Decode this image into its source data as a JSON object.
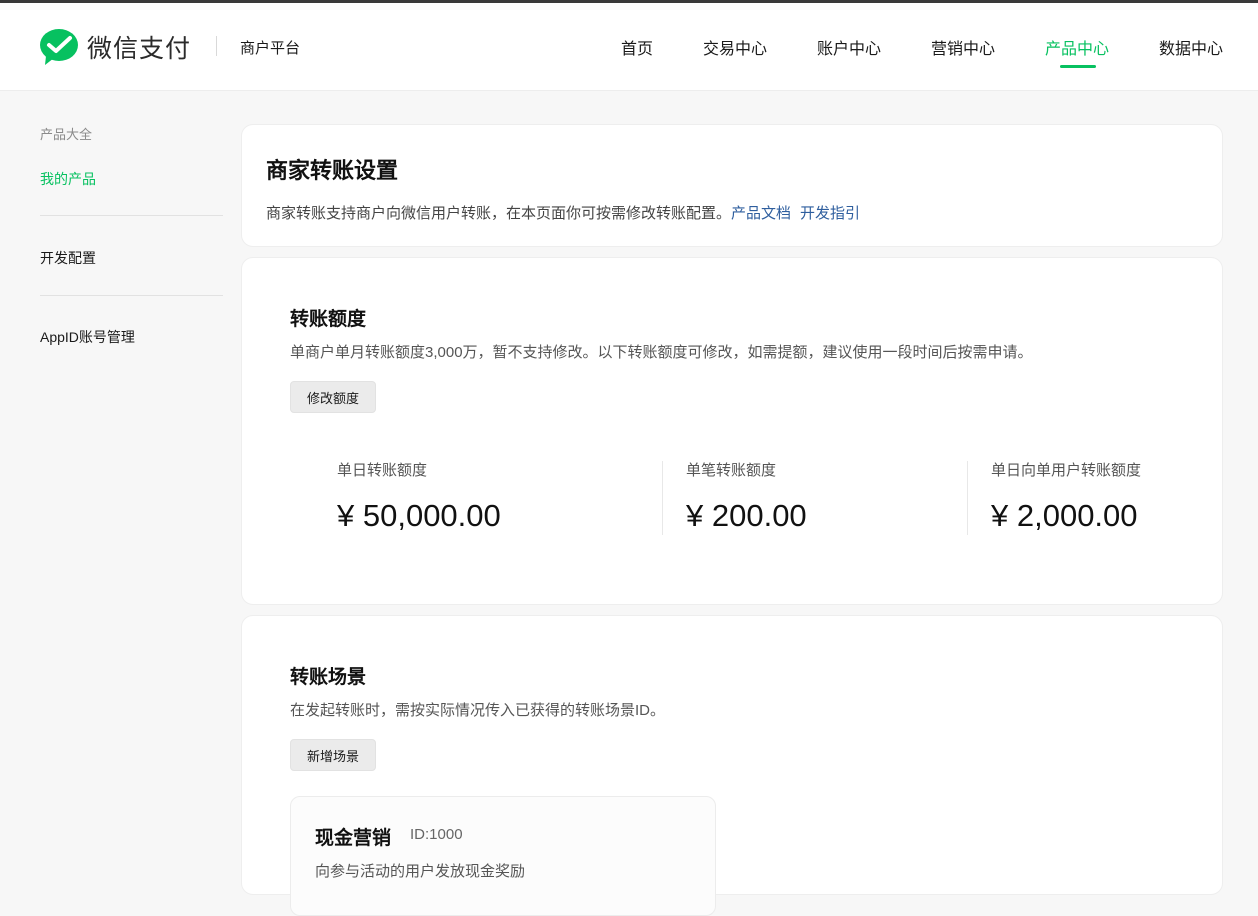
{
  "header": {
    "brand": "微信支付",
    "platform": "商户平台",
    "brand_color": "#07c160",
    "nav": [
      {
        "label": "首页"
      },
      {
        "label": "交易中心"
      },
      {
        "label": "账户中心"
      },
      {
        "label": "营销中心"
      },
      {
        "label": "产品中心",
        "active": true
      },
      {
        "label": "数据中心"
      }
    ]
  },
  "sidebar": {
    "category": "产品大全",
    "items": [
      {
        "label": "我的产品",
        "active": true
      },
      {
        "label": "开发配置"
      },
      {
        "label": "AppID账号管理"
      }
    ]
  },
  "page": {
    "title": "商家转账设置",
    "description": "商家转账支持商户向微信用户转账，在本页面你可按需修改转账配置。",
    "links": [
      "产品文档",
      "开发指引"
    ]
  },
  "quota": {
    "title": "转账额度",
    "description": "单商户单月转账额度3,000万，暂不支持修改。以下转账额度可修改，如需提额，建议使用一段时间后按需申请。",
    "button": "修改额度",
    "stats": [
      {
        "label": "单日转账额度",
        "value": "¥ 50,000.00"
      },
      {
        "label": "单笔转账额度",
        "value": "¥ 200.00"
      },
      {
        "label": "单日向单用户转账额度",
        "value": "¥ 2,000.00"
      }
    ]
  },
  "scenes": {
    "title": "转账场景",
    "description": "在发起转账时，需按实际情况传入已获得的转账场景ID。",
    "button": "新增场景",
    "items": [
      {
        "name": "现金营销",
        "id": "ID:1000",
        "description": "向参与活动的用户发放现金奖励"
      }
    ]
  }
}
